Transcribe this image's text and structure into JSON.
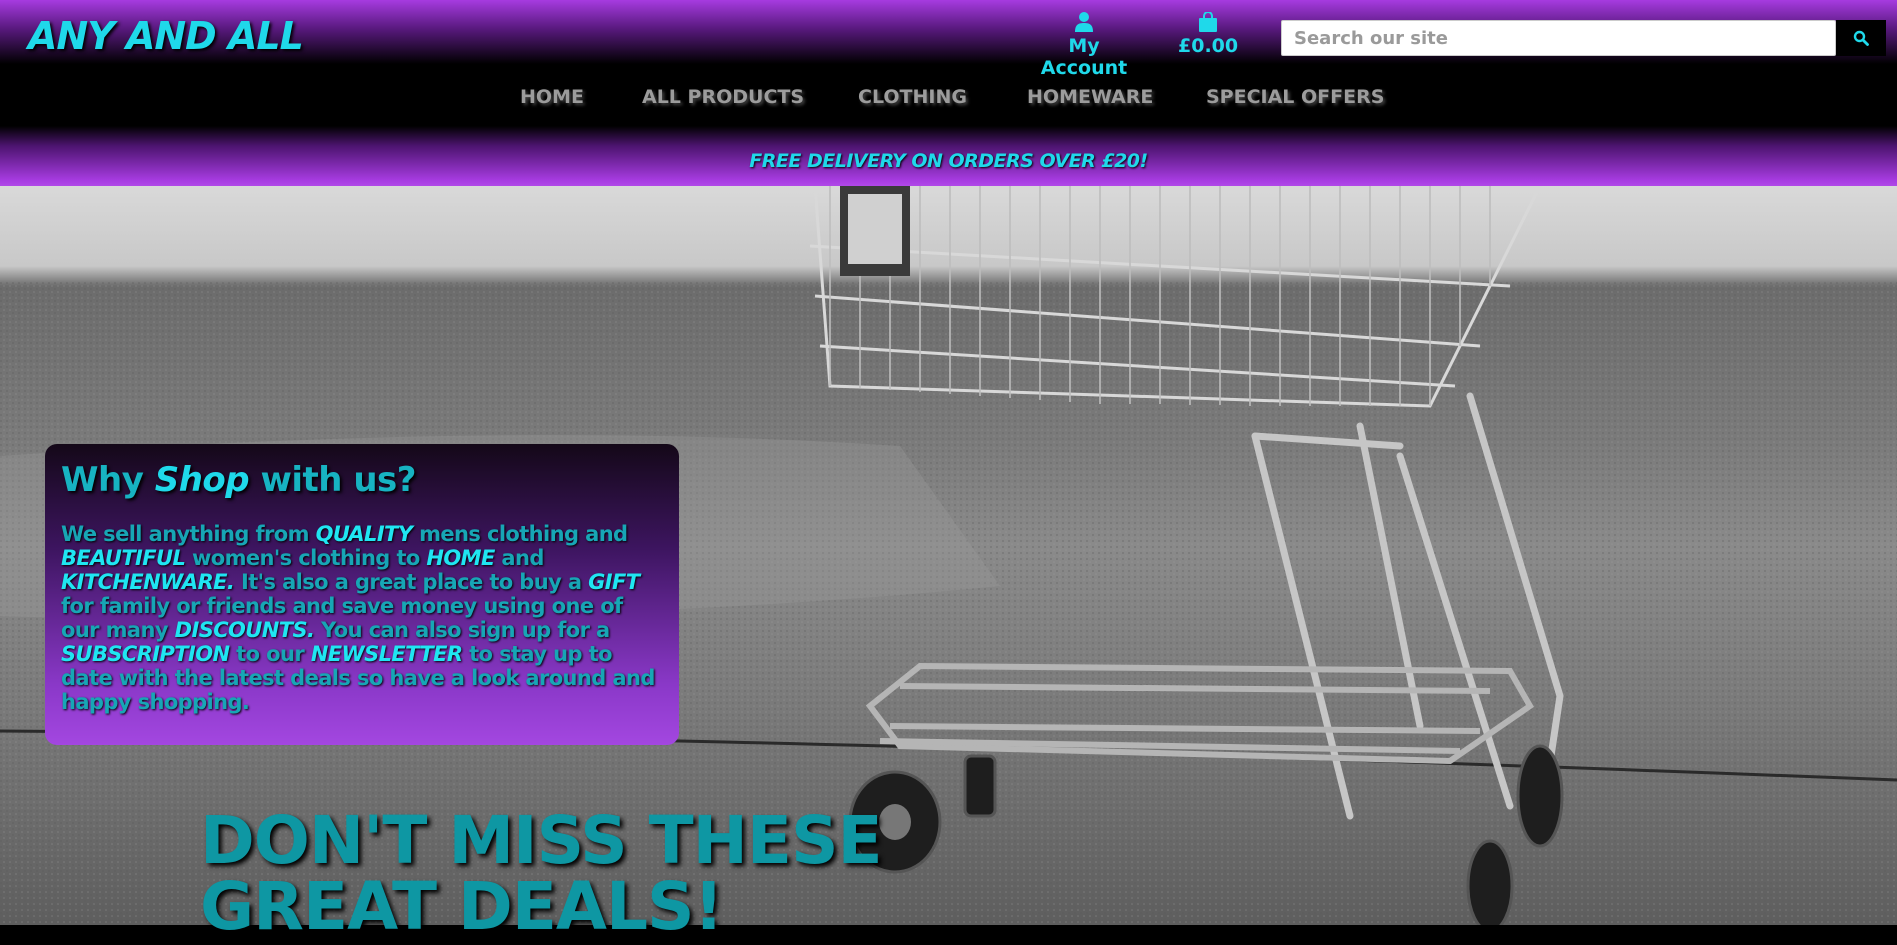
{
  "header": {
    "logo": "ANY AND ALL",
    "account": {
      "label": "My Account",
      "icon": "user-icon"
    },
    "bag": {
      "total": "£0.00",
      "icon": "shopping-bag-icon"
    },
    "search": {
      "placeholder": "Search our site",
      "value": "",
      "icon": "search-icon"
    }
  },
  "nav": {
    "items": [
      {
        "label": "HOME"
      },
      {
        "label": "ALL PRODUCTS"
      },
      {
        "label": "CLOTHING"
      },
      {
        "label": "HOMEWARE"
      },
      {
        "label": "SPECIAL OFFERS"
      }
    ]
  },
  "promo": {
    "text": "FREE DELIVERY ON ORDERS OVER £20!"
  },
  "why": {
    "title_start": "Why",
    "title_em": "Shop",
    "title_end": "with us?",
    "segments": [
      {
        "text": "We sell anything from ",
        "kw": false
      },
      {
        "text": "QUALITY",
        "kw": true
      },
      {
        "text": " mens clothing and ",
        "kw": false
      },
      {
        "text": "BEAUTIFUL",
        "kw": true
      },
      {
        "text": " women's clothing to ",
        "kw": false
      },
      {
        "text": "HOME",
        "kw": true
      },
      {
        "text": " and ",
        "kw": false
      },
      {
        "text": "KITCHENWARE.",
        "kw": true
      },
      {
        "text": " It's also a great place to buy a ",
        "kw": false
      },
      {
        "text": "GIFT",
        "kw": true
      },
      {
        "text": " for family or friends and save money using one of our many ",
        "kw": false
      },
      {
        "text": "DISCOUNTS.",
        "kw": true
      },
      {
        "text": " You can also sign up for a ",
        "kw": false
      },
      {
        "text": "SUBSCRIPTION",
        "kw": true
      },
      {
        "text": " to our ",
        "kw": false
      },
      {
        "text": "NEWSLETTER",
        "kw": true
      },
      {
        "text": " to stay up to date with the latest deals so have a look around and happy shopping.",
        "kw": false
      }
    ]
  },
  "deals": {
    "heading_line1": "DON'T MISS THESE",
    "heading_line2": "GREAT DEALS!"
  },
  "colors": {
    "accent": "#1fd9ea",
    "purple": "#a63be0",
    "nav_text": "#9c9c9c"
  }
}
